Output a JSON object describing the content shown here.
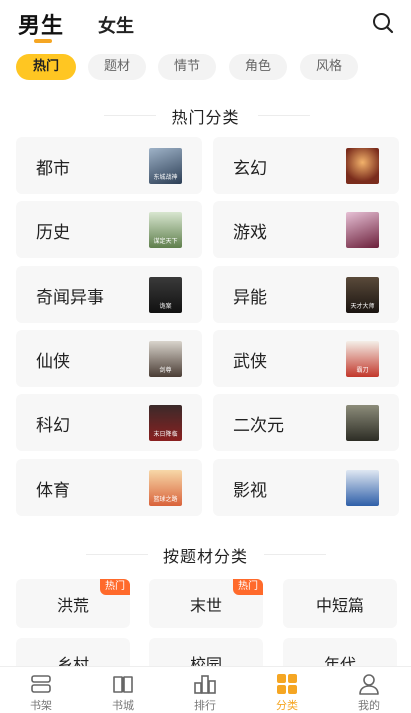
{
  "header": {
    "active_tab": "男生",
    "other_tab": "女生"
  },
  "chips": [
    "热门",
    "题材",
    "情节",
    "角色",
    "风格"
  ],
  "sections": {
    "popular_title": "热门分类",
    "theme_title": "按题材分类"
  },
  "categories": [
    {
      "label": "都市",
      "cover_text": "东城战神"
    },
    {
      "label": "玄幻",
      "cover_text": ""
    },
    {
      "label": "历史",
      "cover_text": "谋定天下"
    },
    {
      "label": "游戏",
      "cover_text": ""
    },
    {
      "label": "奇闻异事",
      "cover_text": "诡案"
    },
    {
      "label": "异能",
      "cover_text": "天才大师"
    },
    {
      "label": "仙侠",
      "cover_text": "剑尊"
    },
    {
      "label": "武侠",
      "cover_text": "霸刀"
    },
    {
      "label": "科幻",
      "cover_text": "末日降临"
    },
    {
      "label": "二次元",
      "cover_text": ""
    },
    {
      "label": "体育",
      "cover_text": "篮球之路"
    },
    {
      "label": "影视",
      "cover_text": ""
    }
  ],
  "themes": [
    {
      "label": "洪荒",
      "badge": "热门"
    },
    {
      "label": "末世",
      "badge": "热门"
    },
    {
      "label": "中短篇",
      "badge": ""
    },
    {
      "label": "乡村",
      "badge": ""
    },
    {
      "label": "校园",
      "badge": ""
    },
    {
      "label": "年代",
      "badge": ""
    }
  ],
  "tabbar": [
    {
      "label": "书架",
      "icon": "bookshelf-icon"
    },
    {
      "label": "书城",
      "icon": "book-open-icon"
    },
    {
      "label": "排行",
      "icon": "ranking-icon"
    },
    {
      "label": "分类",
      "icon": "category-grid-icon"
    },
    {
      "label": "我的",
      "icon": "profile-icon"
    }
  ],
  "colors": {
    "accent": "#ffc622",
    "accent_text": "#f5a623",
    "hot_badge": "#ff6a2b",
    "card_bg": "#f7f7f7"
  }
}
